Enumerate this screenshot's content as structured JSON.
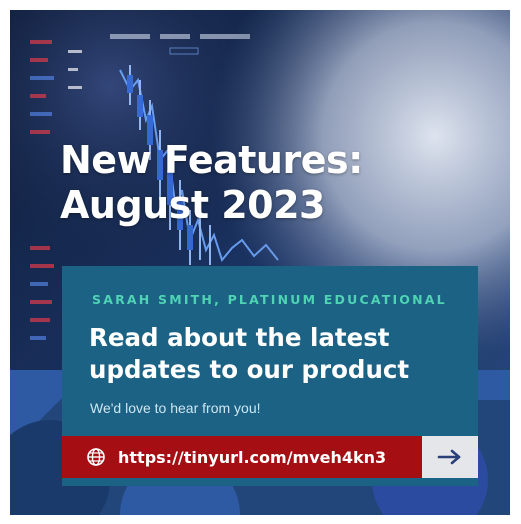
{
  "headline": {
    "line1": "New Features:",
    "line2": "August 2023"
  },
  "panel": {
    "author": "SARAH SMITH, PLATINUM EDUCATIONAL",
    "subhead_line1": "Read about the latest",
    "subhead_line2": "updates to our product",
    "tagline": "We'd love to hear from you!"
  },
  "link": {
    "url_text": "https://tinyurl.com/mveh4kn3",
    "icon": "globe-icon",
    "arrow_icon": "arrow-right-icon"
  },
  "colors": {
    "background_blue": "#1e3f6b",
    "panel_teal": "#1b6285",
    "author_green": "#4fd3b4",
    "link_red": "#a50f14",
    "arrow_grey": "#e4e6ea",
    "arrow_blue": "#2a3f7a"
  }
}
